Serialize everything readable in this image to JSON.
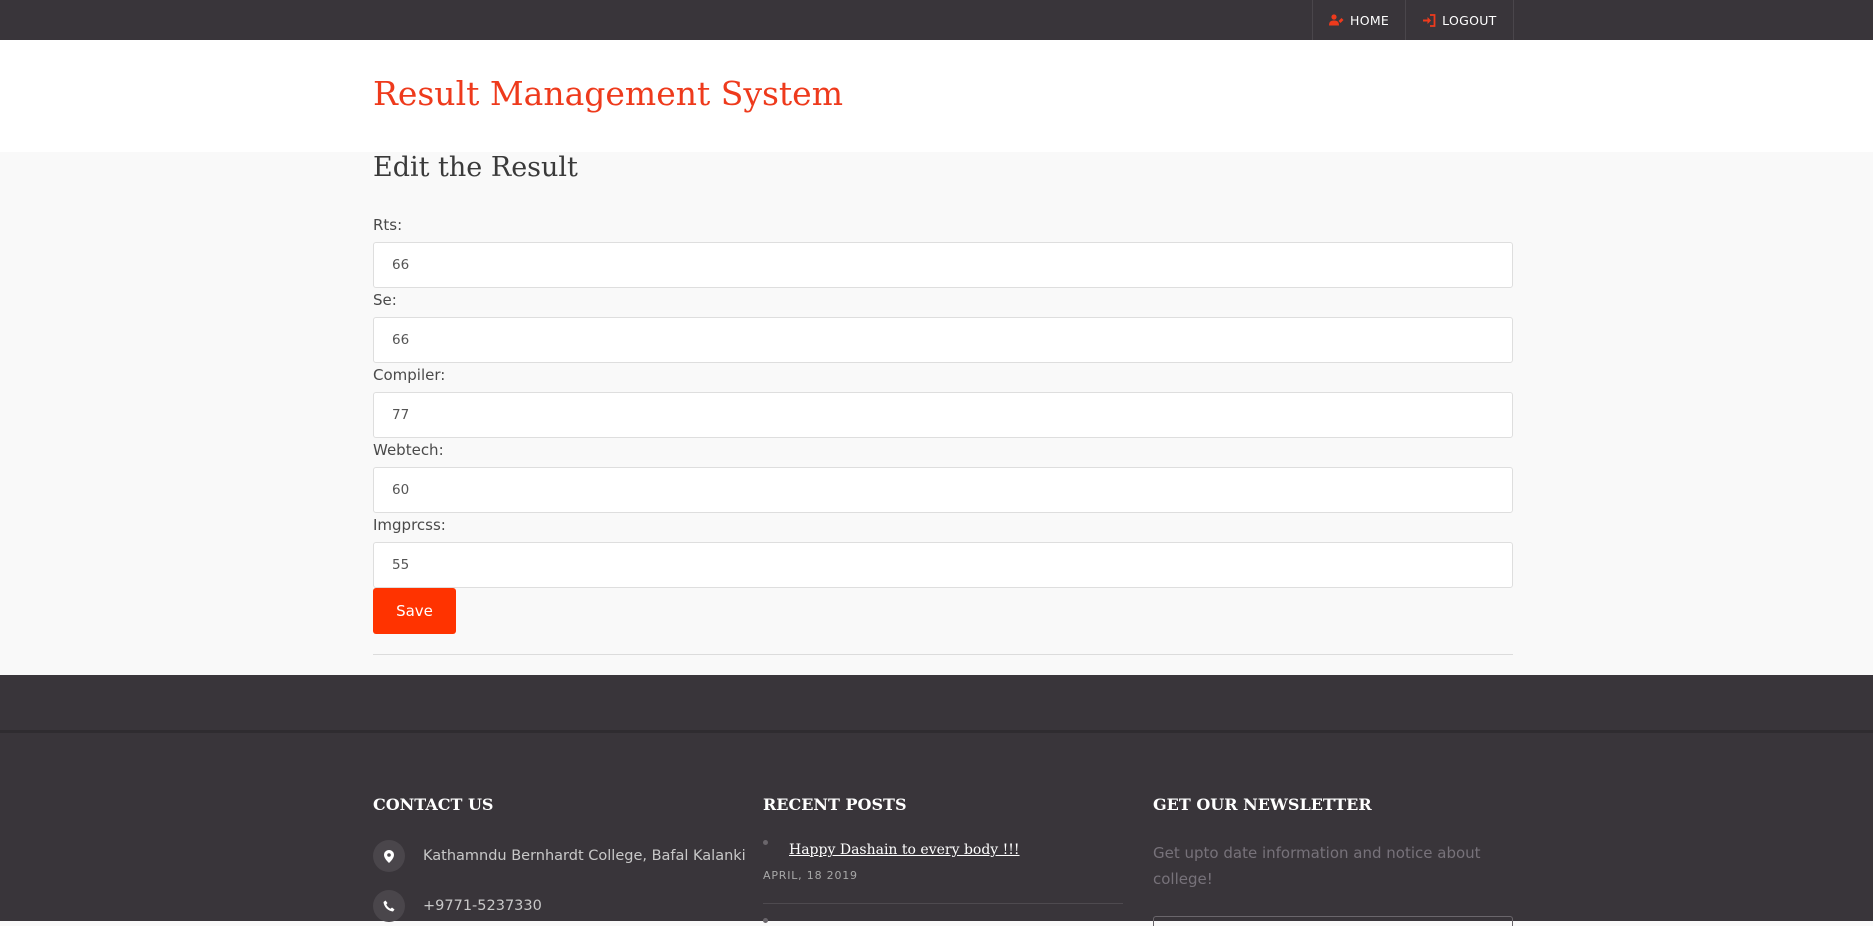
{
  "topnav": {
    "home_label": "HOME",
    "logout_label": "LOGOUT"
  },
  "header": {
    "site_title": "Result Management System"
  },
  "form": {
    "heading": "Edit the Result",
    "fields": [
      {
        "label": "Rts:",
        "value": "66"
      },
      {
        "label": "Se:",
        "value": "66"
      },
      {
        "label": "Compiler:",
        "value": "77"
      },
      {
        "label": "Webtech:",
        "value": "60"
      },
      {
        "label": "Imgprcss:",
        "value": "55"
      }
    ],
    "save_label": "Save"
  },
  "footer": {
    "contact": {
      "heading": "CONTACT US",
      "address": "Kathamndu Bernhardt College, Bafal Kalanki",
      "phone": "+9771-5237330"
    },
    "recent_posts": {
      "heading": "RECENT POSTS",
      "posts": [
        {
          "title": "Happy Dashain to every body !!!",
          "date": "APRIL, 18 2019"
        }
      ]
    },
    "newsletter": {
      "heading": "GET OUR NEWSLETTER",
      "text": "Get upto date information and notice about college!"
    }
  },
  "colors": {
    "accent": "#ff3300",
    "title_red": "#ee3a1c",
    "dark_bar": "#39353a"
  }
}
